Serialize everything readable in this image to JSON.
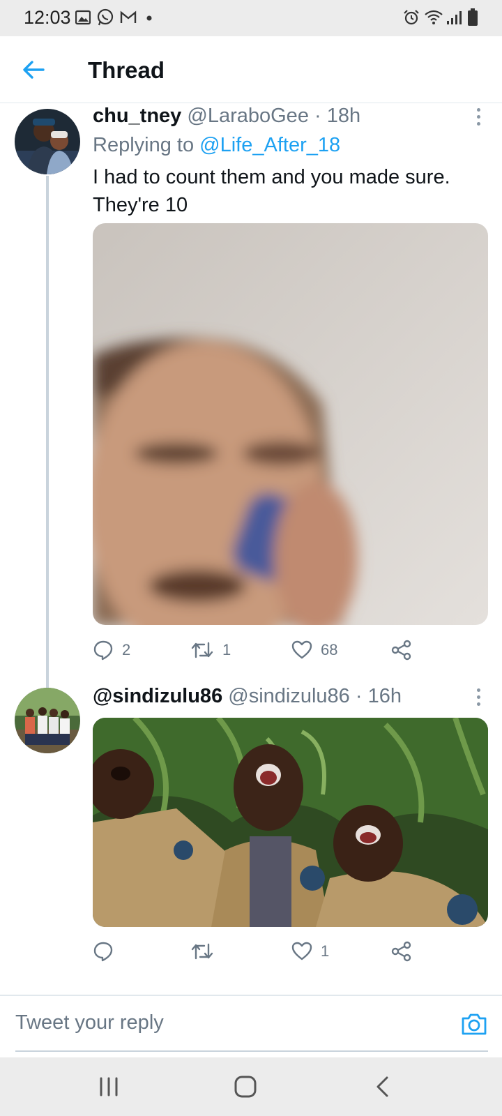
{
  "status_bar": {
    "time": "12:03",
    "left_icons": [
      "image-icon",
      "whatsapp-icon",
      "gmail-icon",
      "dot-icon"
    ],
    "right_icons": [
      "alarm-icon",
      "wifi-icon",
      "signal-icon",
      "battery-icon"
    ]
  },
  "header": {
    "title": "Thread",
    "back_icon": "arrow-left-icon"
  },
  "tweets": [
    {
      "name": "chu_tney",
      "handle": "@LaraboGee",
      "separator": "·",
      "time": "18h",
      "replying_prefix": "Replying to",
      "replying_to": "@Life_After_18",
      "text_line1": "I had to count them and you made sure.",
      "text_line2": "They're 10",
      "media": "blurred photo of a woman on a phone",
      "replies": "2",
      "retweets": "1",
      "likes": "68"
    },
    {
      "name": "@sindizulu86",
      "handle": "@sindizulu86",
      "separator": "·",
      "time": "16h",
      "media": "three uniformed men laughing",
      "replies": "",
      "retweets": "",
      "likes": "1"
    }
  ],
  "composer": {
    "placeholder": "Tweet your reply",
    "camera_icon": "camera-icon"
  },
  "nav_bar": {
    "icons": [
      "recent-apps-icon",
      "home-icon",
      "back-icon"
    ]
  },
  "colors": {
    "accent": "#1da1f2",
    "muted_text": "#687684",
    "text": "#0f1419",
    "thread_line": "#c9d3dc"
  }
}
